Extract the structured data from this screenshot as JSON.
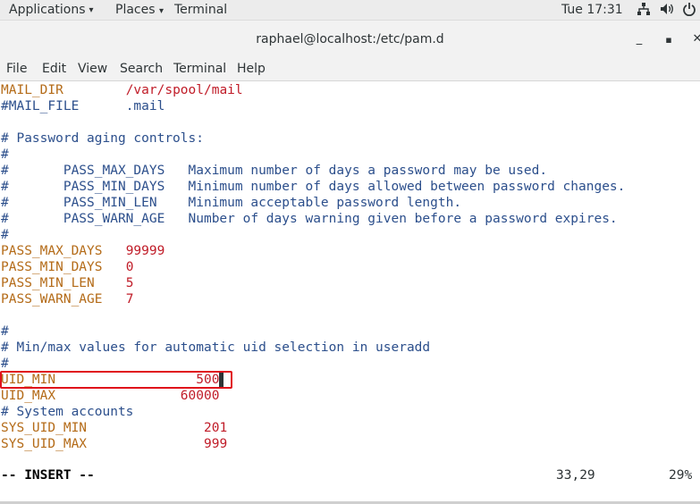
{
  "topbar": {
    "applications": "Applications",
    "places": "Places",
    "terminal": "Terminal",
    "clock": "Tue 17:31",
    "indicators": [
      "network-icon",
      "volume-icon",
      "power-icon"
    ]
  },
  "window": {
    "title": "raphael@localhost:/etc/pam.d",
    "minimize": "_",
    "maximize": "▪",
    "close": "✕"
  },
  "menubar": [
    "File",
    "Edit",
    "View",
    "Search",
    "Terminal",
    "Help"
  ],
  "content": {
    "line1_key": "MAIL_DIR",
    "line1_pad": "        ",
    "line1_val": "/var/spool/mail",
    "line2_key": "#MAIL_FILE",
    "line2_pad": "      ",
    "line2_val": ".mail",
    "pw_header": "# Password aging controls:",
    "pw_hash1": "#",
    "pw_desc1": "#       PASS_MAX_DAYS   Maximum number of days a password may be used.",
    "pw_desc2": "#       PASS_MIN_DAYS   Minimum number of days allowed between password changes.",
    "pw_desc3": "#       PASS_MIN_LEN    Minimum acceptable password length.",
    "pw_desc4": "#       PASS_WARN_AGE   Number of days warning given before a password expires.",
    "pw_hash2": "#",
    "settings": [
      {
        "key": "PASS_MAX_DAYS",
        "pad": "   ",
        "value": "99999"
      },
      {
        "key": "PASS_MIN_DAYS",
        "pad": "   ",
        "value": "0"
      },
      {
        "key": "PASS_MIN_LEN",
        "pad": "    ",
        "value": "5"
      },
      {
        "key": "PASS_WARN_AGE",
        "pad": "   ",
        "value": "7"
      }
    ],
    "uid_hash1": "#",
    "uid_header": "# Min/max values for automatic uid selection in useradd",
    "uid_hash2": "#",
    "uid_min_key": "UID_MIN",
    "uid_min_pad": "                  ",
    "uid_min_val": "500",
    "uid_max_key": "UID_MAX",
    "uid_max_pad": "                ",
    "uid_max_val": "60000",
    "sys_comment": "# System accounts",
    "sys_min_key": "SYS_UID_MIN",
    "sys_min_pad": "               ",
    "sys_min_val": "201",
    "sys_max_key": "SYS_UID_MAX",
    "sys_max_pad": "               ",
    "sys_max_val": "999"
  },
  "status": {
    "mode": "-- INSERT --",
    "position": "33,29",
    "percent": "29%"
  },
  "colors": {
    "keyword": "#b46b18",
    "value": "#c01c28",
    "comment": "#2c4f8c",
    "highlight_box": "#e0121b"
  }
}
